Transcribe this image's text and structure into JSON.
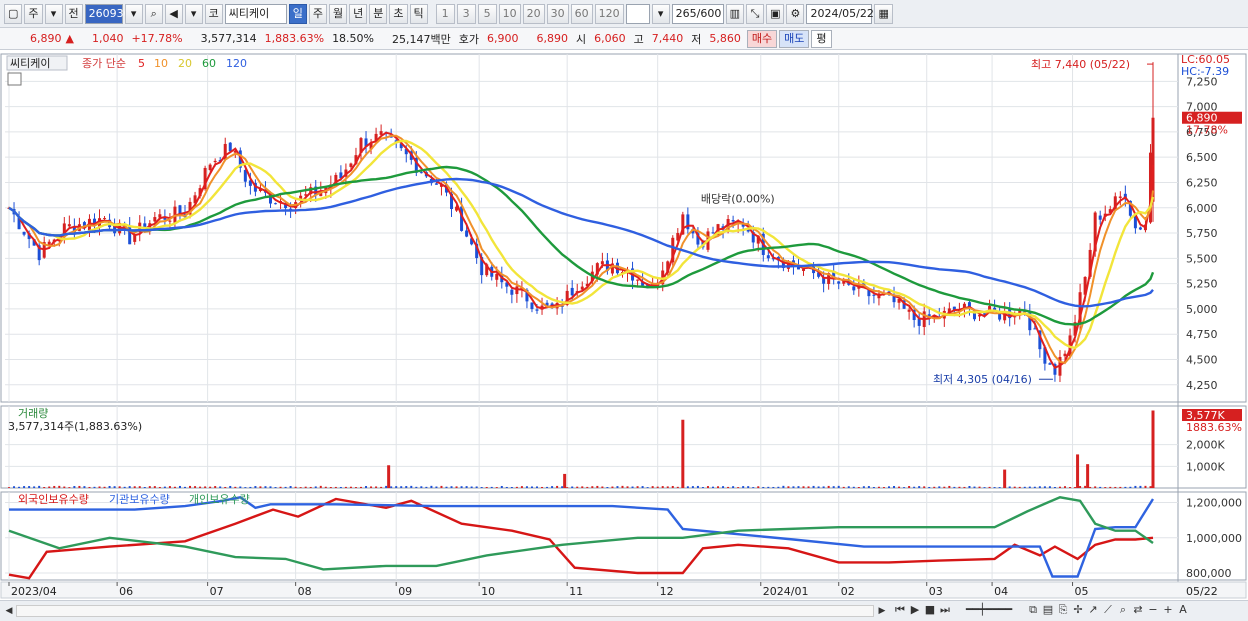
{
  "toolbar": {
    "tab_stock": "주",
    "tab_prev": "전",
    "code": "260930",
    "market": "코",
    "name": "씨티케이",
    "periods": [
      "일",
      "주",
      "월",
      "년",
      "분",
      "초",
      "틱"
    ],
    "active_period": "일",
    "intervals": [
      "1",
      "3",
      "5",
      "10",
      "20",
      "30",
      "60",
      "120"
    ],
    "count": "265/600",
    "date": "2024/05/22"
  },
  "quote": {
    "price": "6,890",
    "arrow": "▲",
    "change": "1,040",
    "change_pct": "+17.78%",
    "volume": "3,577,314",
    "volume_ratio": "1,883.63%",
    "turnover": "18.50%",
    "amount": "25,147백만",
    "bid_label": "호가",
    "ask": "6,900",
    "bid": "6,890",
    "open_label": "시",
    "open": "6,060",
    "high_label": "고",
    "high": "7,440",
    "low_label": "저",
    "low": "5,860",
    "buy_btn": "매수",
    "sell_btn": "매도",
    "eval_btn": "평"
  },
  "colors": {
    "up": "#d62020",
    "down": "#1c4fd6",
    "ma5": "#e01f1f",
    "ma10": "#f0912a",
    "ma20": "#f2e53a",
    "ma60": "#1e9a3c",
    "ma120": "#2f5fe0",
    "foreign": "#d61616",
    "institution": "#2f63e0",
    "individual": "#2f9a5a"
  },
  "chart_data": [
    {
      "type": "candlestick",
      "title": "씨티케이",
      "legend": [
        "종가 단순",
        "5",
        "10",
        "20",
        "60",
        "120"
      ],
      "x_ticks": [
        "2023/04",
        "06",
        "07",
        "08",
        "09",
        "10",
        "11",
        "12",
        "2024/01",
        "02",
        "03",
        "04",
        "05"
      ],
      "x_tick_days": [
        0,
        43,
        79,
        114,
        154,
        187,
        222,
        258,
        299,
        330,
        365,
        391,
        423
      ],
      "y_ticks": [
        4250,
        4500,
        4750,
        5000,
        5250,
        5500,
        5750,
        6000,
        6250,
        6500,
        6750,
        7000,
        7250
      ],
      "ylim": [
        4080,
        7520
      ],
      "day_range": [
        0,
        455
      ],
      "top_labels": {
        "lc": "LC:60.05",
        "hc": "HC:-7.39"
      },
      "last_price_label": "6,890",
      "last_pct_label": "17.78%",
      "annotations": {
        "high": "최고 7,440 (05/22)",
        "low": "최저 4,305 (04/16)",
        "dividend": "배당락(0.00%)"
      },
      "close_keypoints": [
        [
          0,
          6000
        ],
        [
          12,
          5550
        ],
        [
          22,
          5800
        ],
        [
          38,
          5900
        ],
        [
          48,
          5700
        ],
        [
          58,
          5900
        ],
        [
          70,
          5950
        ],
        [
          80,
          6450
        ],
        [
          88,
          6600
        ],
        [
          96,
          6200
        ],
        [
          104,
          6100
        ],
        [
          112,
          6050
        ],
        [
          122,
          6150
        ],
        [
          132,
          6300
        ],
        [
          140,
          6650
        ],
        [
          148,
          6700
        ],
        [
          156,
          6550
        ],
        [
          163,
          6400
        ],
        [
          172,
          6200
        ],
        [
          180,
          5850
        ],
        [
          188,
          5400
        ],
        [
          196,
          5250
        ],
        [
          204,
          5150
        ],
        [
          212,
          5000
        ],
        [
          218,
          5000
        ],
        [
          226,
          5250
        ],
        [
          234,
          5400
        ],
        [
          240,
          5450
        ],
        [
          248,
          5350
        ],
        [
          256,
          5200
        ],
        [
          262,
          5550
        ],
        [
          268,
          5950
        ],
        [
          274,
          5650
        ],
        [
          282,
          5800
        ],
        [
          292,
          5850
        ],
        [
          300,
          5600
        ],
        [
          310,
          5450
        ],
        [
          320,
          5350
        ],
        [
          330,
          5250
        ],
        [
          340,
          5150
        ],
        [
          350,
          5100
        ],
        [
          360,
          4900
        ],
        [
          368,
          4900
        ],
        [
          378,
          5000
        ],
        [
          388,
          4950
        ],
        [
          396,
          4950
        ],
        [
          404,
          5000
        ],
        [
          410,
          4600
        ],
        [
          416,
          4400
        ],
        [
          422,
          4700
        ],
        [
          428,
          5300
        ],
        [
          432,
          5900
        ],
        [
          438,
          6000
        ],
        [
          444,
          6150
        ],
        [
          448,
          5800
        ],
        [
          452,
          5850
        ],
        [
          455,
          6890
        ]
      ],
      "volume_panel": {
        "title": "거래량",
        "value_label": "3,577,314주(1,883.63%)",
        "max_label": "3,577K",
        "max_pct_label": "1883.63%",
        "y_ticks": [
          "2,000K",
          "1,000K"
        ],
        "y_tick_values": [
          2000,
          1000
        ],
        "ymax": 3600,
        "spikes": [
          [
            151,
            1050
          ],
          [
            221,
            650
          ],
          [
            268,
            3150
          ],
          [
            396,
            850
          ],
          [
            425,
            1550
          ],
          [
            429,
            1100
          ],
          [
            455,
            3577
          ]
        ]
      },
      "holdings_panel": {
        "series_names": [
          "외국인보유수량",
          "기관보유수량",
          "개인보유수량"
        ],
        "y_ticks": [
          "1,200,000",
          "1,000,000",
          "800,000"
        ],
        "y_tick_values": [
          1200000,
          1000000,
          800000
        ],
        "ylim": [
          760000,
          1260000
        ],
        "foreign": [
          [
            0,
            790000
          ],
          [
            8,
            770000
          ],
          [
            15,
            920000
          ],
          [
            40,
            950000
          ],
          [
            70,
            980000
          ],
          [
            90,
            1080000
          ],
          [
            105,
            1160000
          ],
          [
            115,
            1120000
          ],
          [
            130,
            1220000
          ],
          [
            150,
            1170000
          ],
          [
            160,
            1210000
          ],
          [
            180,
            1080000
          ],
          [
            200,
            1040000
          ],
          [
            215,
            990000
          ],
          [
            225,
            830000
          ],
          [
            250,
            800000
          ],
          [
            268,
            800000
          ],
          [
            276,
            940000
          ],
          [
            290,
            960000
          ],
          [
            310,
            940000
          ],
          [
            330,
            860000
          ],
          [
            350,
            860000
          ],
          [
            370,
            870000
          ],
          [
            392,
            880000
          ],
          [
            400,
            960000
          ],
          [
            410,
            900000
          ],
          [
            416,
            950000
          ],
          [
            425,
            880000
          ],
          [
            432,
            960000
          ],
          [
            440,
            990000
          ],
          [
            448,
            990000
          ],
          [
            455,
            1000000
          ]
        ],
        "institution": [
          [
            0,
            1160000
          ],
          [
            50,
            1160000
          ],
          [
            70,
            1180000
          ],
          [
            85,
            1210000
          ],
          [
            92,
            1230000
          ],
          [
            98,
            1170000
          ],
          [
            104,
            1190000
          ],
          [
            130,
            1190000
          ],
          [
            170,
            1180000
          ],
          [
            210,
            1180000
          ],
          [
            240,
            1180000
          ],
          [
            262,
            1160000
          ],
          [
            268,
            1050000
          ],
          [
            290,
            1020000
          ],
          [
            312,
            990000
          ],
          [
            340,
            950000
          ],
          [
            360,
            950000
          ],
          [
            392,
            950000
          ],
          [
            410,
            950000
          ],
          [
            415,
            780000
          ],
          [
            425,
            780000
          ],
          [
            432,
            1050000
          ],
          [
            440,
            1060000
          ],
          [
            448,
            1060000
          ],
          [
            455,
            1220000
          ]
        ],
        "individual": [
          [
            0,
            1040000
          ],
          [
            20,
            940000
          ],
          [
            40,
            1000000
          ],
          [
            70,
            950000
          ],
          [
            90,
            890000
          ],
          [
            110,
            880000
          ],
          [
            125,
            820000
          ],
          [
            150,
            840000
          ],
          [
            170,
            840000
          ],
          [
            190,
            900000
          ],
          [
            220,
            960000
          ],
          [
            250,
            1000000
          ],
          [
            268,
            1000000
          ],
          [
            290,
            1040000
          ],
          [
            330,
            1060000
          ],
          [
            370,
            1060000
          ],
          [
            392,
            1060000
          ],
          [
            405,
            1150000
          ],
          [
            413,
            1200000
          ],
          [
            418,
            1230000
          ],
          [
            426,
            1210000
          ],
          [
            432,
            1080000
          ],
          [
            440,
            1040000
          ],
          [
            448,
            1040000
          ],
          [
            455,
            970000
          ]
        ]
      }
    }
  ]
}
